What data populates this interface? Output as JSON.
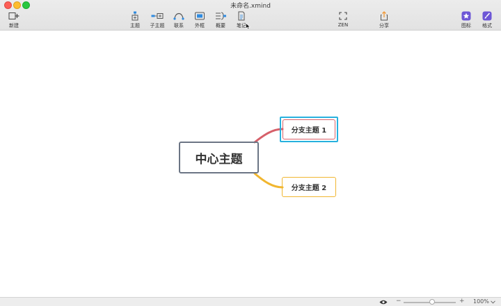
{
  "window": {
    "title": "未命名.xmind"
  },
  "toolbar": {
    "new": "新建",
    "topic": "主题",
    "subtopic": "子主题",
    "relationship": "联系",
    "boundary": "外框",
    "summary": "概要",
    "notes": "笔记",
    "zen": "ZEN",
    "share": "分享",
    "icons": "图标",
    "format": "格式"
  },
  "mindmap": {
    "central": "中心主题",
    "subtopics": [
      "分支主题 1",
      "分支主题 2"
    ],
    "colors": {
      "central_border": "#6b7584",
      "branch1": "#d6606a",
      "branch2": "#f1b62f",
      "selection": "#27b1de"
    }
  },
  "statusbar": {
    "zoom_minus": "−",
    "zoom_plus": "+",
    "zoom_level": "100%",
    "zoom_fraction": 0.5
  }
}
